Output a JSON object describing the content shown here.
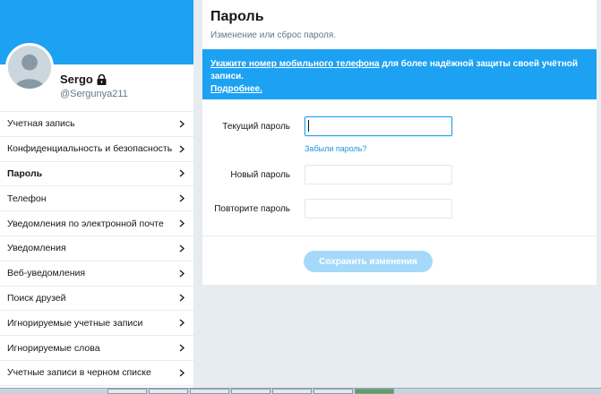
{
  "profile": {
    "name": "Sergo",
    "handle": "@Sergunya211"
  },
  "menu": {
    "items": [
      {
        "label": "Учетная запись",
        "active": false
      },
      {
        "label": "Конфиденциальность и безопасность",
        "active": false
      },
      {
        "label": "Пароль",
        "active": true
      },
      {
        "label": "Телефон",
        "active": false
      },
      {
        "label": "Уведомления по электронной почте",
        "active": false
      },
      {
        "label": "Уведомления",
        "active": false
      },
      {
        "label": "Веб-уведомления",
        "active": false
      },
      {
        "label": "Поиск друзей",
        "active": false
      },
      {
        "label": "Игнорируемые учетные записи",
        "active": false
      },
      {
        "label": "Игнорируемые слова",
        "active": false
      },
      {
        "label": "Учетные записи в черном списке",
        "active": false
      }
    ]
  },
  "page": {
    "title": "Пароль",
    "subtitle": "Изменение или сброс пароля."
  },
  "notice": {
    "link_text": "Укажите номер мобильного телефона",
    "text": " для более надёжной защиты своей учётной записи.",
    "more_link": "Подробнее."
  },
  "form": {
    "current_password_label": "Текущий пароль",
    "current_password_value": "",
    "forgot_link": "Забыли пароль?",
    "new_password_label": "Новый пароль",
    "new_password_value": "",
    "repeat_password_label": "Повторите пароль",
    "repeat_password_value": "",
    "save_label": "Сохранить изменения"
  },
  "colors": {
    "accent": "#1da1f2",
    "background": "#e6ecf0",
    "button_disabled": "#a5d9fa"
  }
}
